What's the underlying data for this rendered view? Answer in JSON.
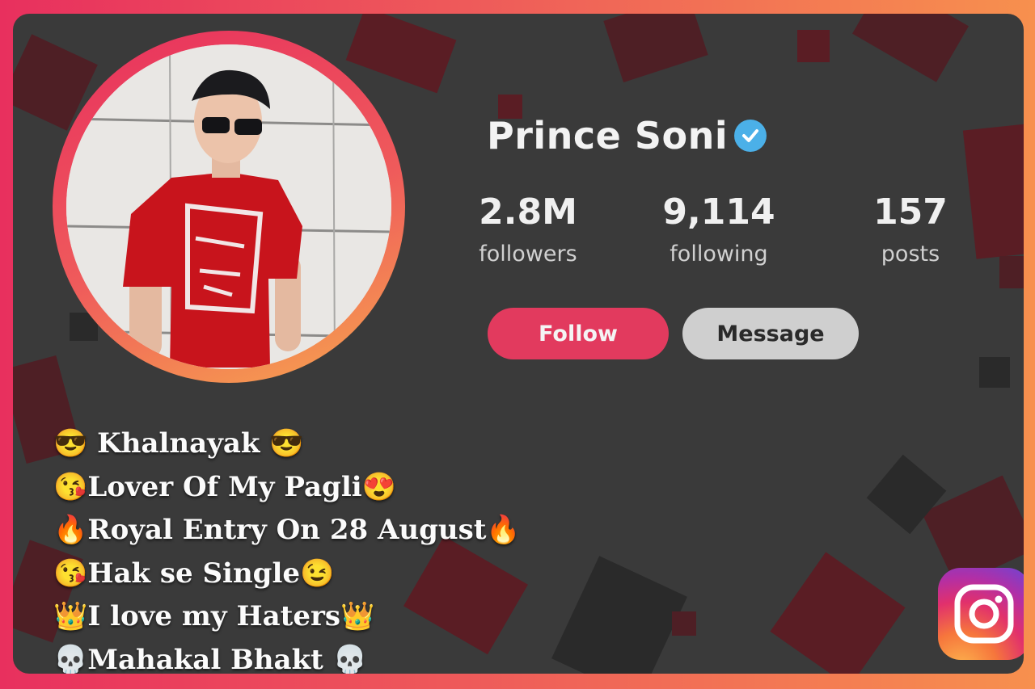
{
  "profile": {
    "name": "Prince Soni",
    "verified": true,
    "stats": {
      "followers": {
        "value": "2.8M",
        "label": "followers"
      },
      "following": {
        "value": "9,114",
        "label": "following"
      },
      "posts": {
        "value": "157",
        "label": "posts"
      }
    },
    "buttons": {
      "follow": "Follow",
      "message": "Message"
    }
  },
  "bio": [
    "😎 Khalnayak 😎",
    "😘Lover Of My Pagli😍",
    "🔥Royal Entry On 28 August🔥",
    "😘Hak se Single😉",
    "👑I love my Haters👑",
    "💀Mahakal Bhakt 💀"
  ],
  "colors": {
    "accent": "#e23a5e",
    "verified": "#4bb0e8",
    "panel": "#3a3a3a",
    "frame_gradient": [
      "#e8305e",
      "#f7904e"
    ]
  },
  "icons": {
    "verified": "verified-badge-icon",
    "brand": "instagram-logo-icon"
  }
}
